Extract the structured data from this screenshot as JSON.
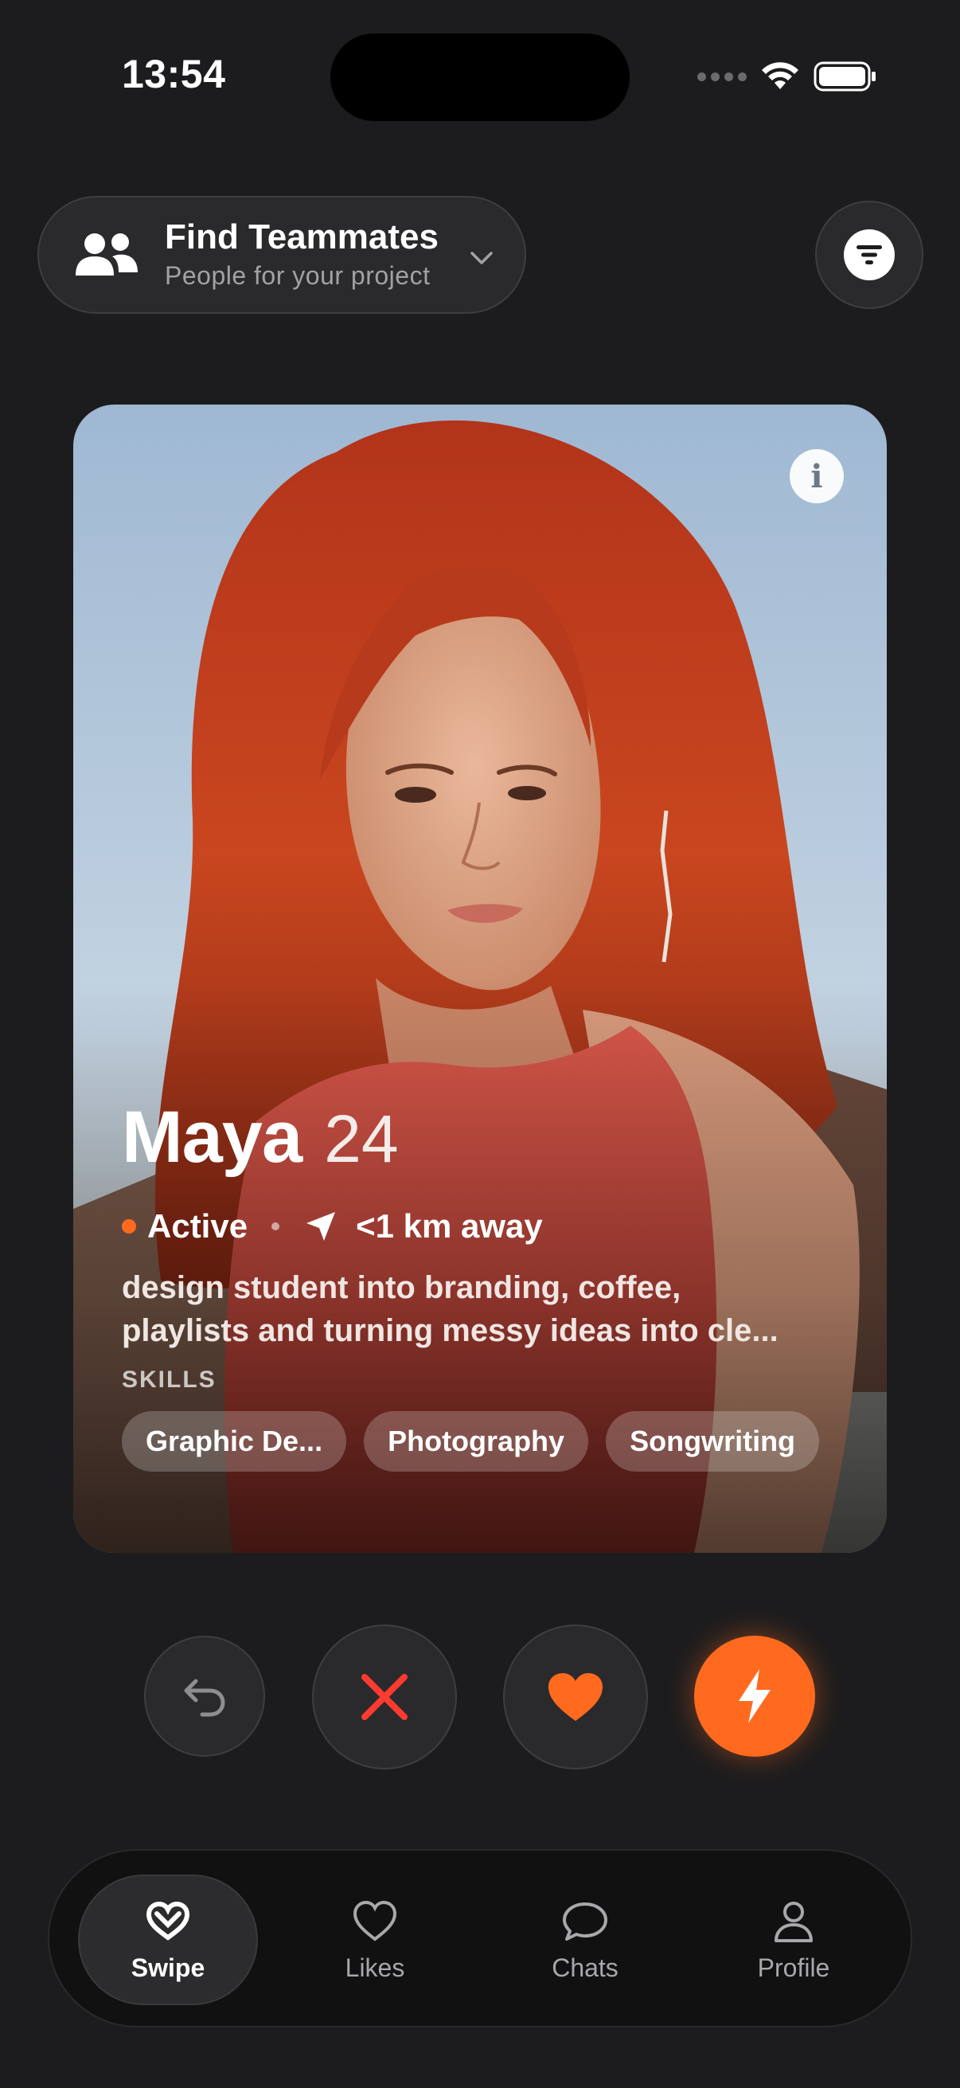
{
  "status_bar": {
    "time": "13:54"
  },
  "header": {
    "title": "Find Teammates",
    "subtitle": "People for your project",
    "icon": "people-icon",
    "dropdown_icon": "chevron-down-icon"
  },
  "filter": {
    "icon": "filter-icon"
  },
  "card": {
    "info_icon_text": "i",
    "name": "Maya",
    "age": "24",
    "status": "Active",
    "distance": "<1 km away",
    "bio_line1": "design student into branding, coffee,",
    "bio_line2": "playlists and turning messy ideas into cle...",
    "skills_label": "SKILLS",
    "skills": [
      "Graphic De...",
      "Photography",
      "Songwriting"
    ]
  },
  "actions": {
    "undo_icon": "undo-icon",
    "pass_icon": "close-icon",
    "like_icon": "heart-icon",
    "boost_icon": "lightning-icon"
  },
  "tabs": [
    {
      "label": "Swipe",
      "icon": "swipe-icon",
      "active": true
    },
    {
      "label": "Likes",
      "icon": "heart-outline-icon",
      "active": false
    },
    {
      "label": "Chats",
      "icon": "chat-bubble-icon",
      "active": false
    },
    {
      "label": "Profile",
      "icon": "person-icon",
      "active": false
    }
  ],
  "colors": {
    "background": "#1c1c1e",
    "accent": "#ff6a1f",
    "pass": "#ff3b30"
  }
}
